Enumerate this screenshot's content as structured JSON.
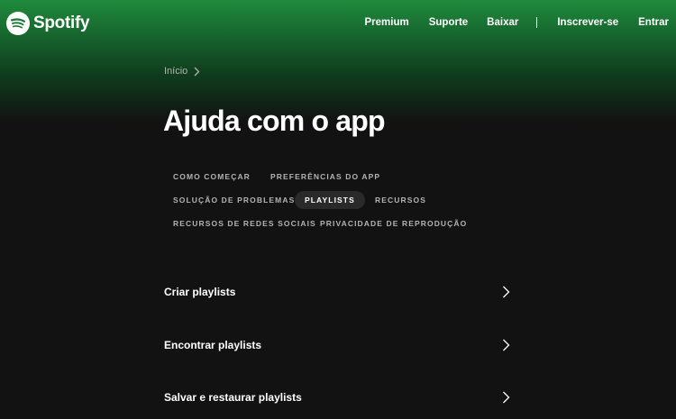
{
  "brand": {
    "name": "Spotify",
    "accent_color": "#1ed760",
    "icon": "spotify-logo-icon"
  },
  "nav": {
    "premium": "Premium",
    "suporte": "Suporte",
    "baixar": "Baixar",
    "inscrever": "Inscrever-se",
    "entrar": "Entrar"
  },
  "breadcrumb": {
    "home": "Início",
    "separator_icon": "chevron-right-icon"
  },
  "page": {
    "title": "Ajuda com o app"
  },
  "tabs": {
    "como_comecar": "COMO COMEÇAR",
    "preferencias": "PREFERÊNCIAS DO APP",
    "solucao": "SOLUÇÃO DE PROBLEMAS",
    "playlists": "PLAYLISTS",
    "recursos": "RECURSOS",
    "redes_sociais": "RECURSOS DE REDES SOCIAIS",
    "privacidade": "PRIVACIDADE DE REPRODUÇÃO",
    "active": "PLAYLISTS"
  },
  "articles": [
    {
      "label": "Criar playlists",
      "icon": "chevron-right-icon"
    },
    {
      "label": "Encontrar playlists",
      "icon": "chevron-right-icon"
    },
    {
      "label": "Salvar e restaurar playlists",
      "icon": "chevron-right-icon"
    }
  ]
}
